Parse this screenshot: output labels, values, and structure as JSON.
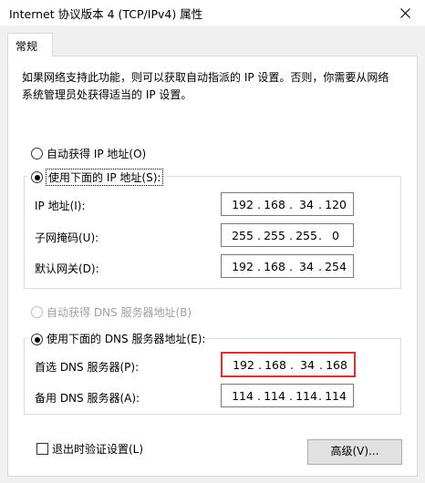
{
  "window": {
    "title": "Internet 协议版本 4 (TCP/IPv4) 属性"
  },
  "tabs": [
    {
      "label": "常规",
      "active": true
    }
  ],
  "description": "如果网络支持此功能，则可以获取自动指派的 IP 设置。否则，你需要从网络系统管理员处获得适当的 IP 设置。",
  "ip_section": {
    "auto_label": "自动获得 IP 地址(O)",
    "manual_label": "使用下面的 IP 地址(S):",
    "fields": [
      {
        "label": "IP 地址(I):",
        "octets": [
          "192",
          "168",
          "34",
          "120"
        ]
      },
      {
        "label": "子网掩码(U):",
        "octets": [
          "255",
          "255",
          "255",
          "0"
        ]
      },
      {
        "label": "默认网关(D):",
        "octets": [
          "192",
          "168",
          "34",
          "254"
        ]
      }
    ]
  },
  "dns_section": {
    "auto_label": "自动获得 DNS 服务器地址(B)",
    "manual_label": "使用下面的 DNS 服务器地址(E):",
    "fields": [
      {
        "label": "首选 DNS 服务器(P):",
        "octets": [
          "192",
          "168",
          "34",
          "168"
        ]
      },
      {
        "label": "备用 DNS 服务器(A):",
        "octets": [
          "114",
          "114",
          "114",
          "114"
        ]
      }
    ]
  },
  "validate_label": "退出时验证设置(L)",
  "advanced_button": "高级(V)...",
  "colors": {
    "highlight": "#d93030",
    "dialog_bg": "#f0f0f0"
  }
}
